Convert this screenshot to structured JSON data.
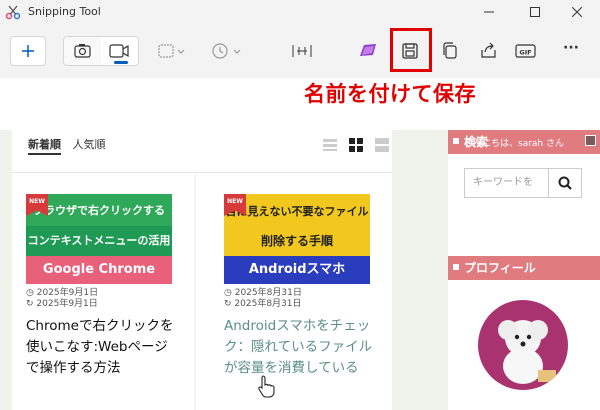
{
  "window": {
    "title": "Snipping Tool",
    "controls": {
      "minimize": "—",
      "maximize": "☐",
      "close": "✕"
    }
  },
  "toolbar": {
    "tools": [
      "new-snip",
      "screenshot-mode",
      "video-mode",
      "snip-shape",
      "delay-timer",
      "trim",
      "edit-in-paint",
      "save",
      "copy",
      "share",
      "gif",
      "more"
    ],
    "gif_label": "GIF",
    "more_label": "···"
  },
  "annotation": {
    "label": "名前を付けて保存",
    "color": "#e00000"
  },
  "webpage": {
    "sort_tabs": [
      "新着順",
      "人気順"
    ],
    "posts": [
      {
        "thumb_lines": [
          "ブラウザで右クリックする",
          "コンテキストメニューの活用",
          "Google Chrome"
        ],
        "new_tag": "NEW",
        "published": "2025年9月1日",
        "updated": "2025年9月1日",
        "title": "Chromeで右クリックを使いこなす:Webページで操作する方法"
      },
      {
        "thumb_lines": [
          "目に見えない不要なファイル",
          "削除する手順",
          "Androidスマホ"
        ],
        "new_tag": "NEW",
        "published": "2025年8月31日",
        "updated": "2025年8月31日",
        "title": "Androidスマホをチェック：隠れているファイルが容量を消費している"
      }
    ],
    "sidebar": {
      "search_heading": "検索",
      "greeting": "こんにちは、sarah さん",
      "search_placeholder": "キーワードを",
      "profile_heading": "プロフィール"
    }
  },
  "colors": {
    "accent": "#005fb8",
    "sidebar_heading": "#e07b80",
    "visited_link": "#5b8f8a"
  }
}
